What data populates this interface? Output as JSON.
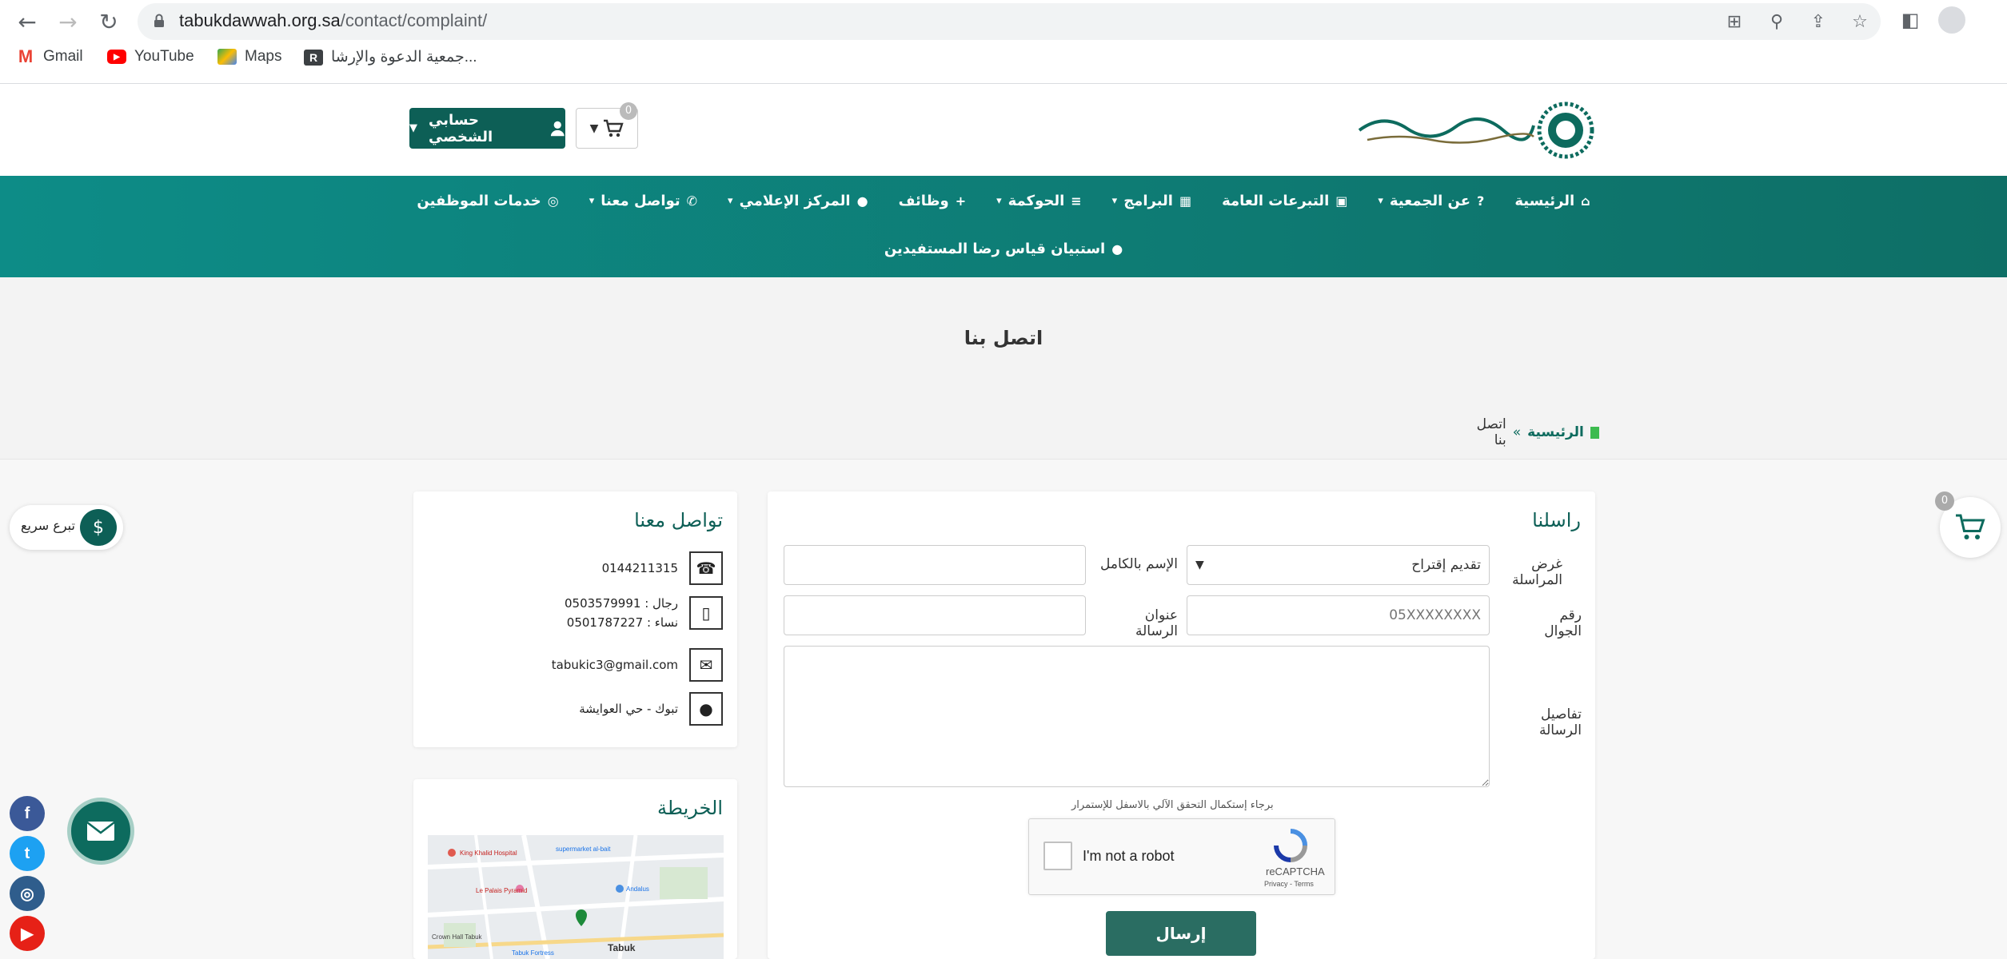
{
  "browser": {
    "url_host": "tabukdawwah.org.sa",
    "url_path": "/contact/complaint/",
    "bookmarks": [
      {
        "label": "Gmail",
        "icon": "gmail-icon",
        "color": "#ea4335"
      },
      {
        "label": "YouTube",
        "icon": "youtube-icon",
        "color": "#ff0000"
      },
      {
        "label": "Maps",
        "icon": "maps-icon",
        "color": "#34a853"
      },
      {
        "label": "جمعية الدعوة والإرشا...",
        "icon": "r-icon",
        "color": "#3c4043"
      }
    ]
  },
  "header": {
    "account_label": "حسابي الشخصي",
    "cart_count": "0"
  },
  "nav": {
    "row1": [
      {
        "label": "الرئيسية",
        "icon": "⌂",
        "chevron": false
      },
      {
        "label": "عن الجمعية",
        "icon": "?",
        "chevron": true
      },
      {
        "label": "التبرعات العامة",
        "icon": "▣",
        "chevron": false
      },
      {
        "label": "البرامج",
        "icon": "▦",
        "chevron": true
      },
      {
        "label": "الحوكمة",
        "icon": "≡",
        "chevron": true
      },
      {
        "label": "وظائف",
        "icon": "+",
        "chevron": false
      },
      {
        "label": "المركز الإعلامي",
        "icon": "●",
        "chevron": true
      },
      {
        "label": "تواصل معنا",
        "icon": "✆",
        "chevron": true
      },
      {
        "label": "خدمات الموظفين",
        "icon": "◎",
        "chevron": false
      }
    ],
    "row2": [
      {
        "label": "استبيان قياس رضا المستفيدين",
        "icon": "●",
        "chevron": false
      }
    ]
  },
  "hero": {
    "title": "اتصل بنا",
    "breadcrumb_home": "الرئيسية",
    "breadcrumb_sep": "»",
    "breadcrumb_current": "اتصل بنا"
  },
  "form": {
    "title": "راسلنا",
    "purpose_label": "غرض المراسلة",
    "purpose_value": "تقديم إقتراح",
    "name_label": "الإسم بالكامل",
    "name_value": "",
    "mobile_label": "رقم الجوال",
    "mobile_placeholder": "05XXXXXXXX",
    "subject_label": "عنوان الرسالة",
    "subject_value": "",
    "details_label": "تفاصيل الرسالة",
    "captcha_note": "برجاء إستكمال التحقق الآلي بالاسفل للإستمرار",
    "captcha_text": "I'm not a robot",
    "captcha_brand": "reCAPTCHA",
    "captcha_links": "Privacy - Terms",
    "submit_label": "إرسال"
  },
  "contact": {
    "title": "تواصل معنا",
    "phone": "0144211315",
    "mobile_men": "رجال : 0503579991",
    "mobile_women": "نساء : 0501787227",
    "email": "tabukic3@gmail.com",
    "address": "تبوك - حي العوايشة"
  },
  "map": {
    "title": "الخريطة",
    "labels": {
      "hospital": "King Khalid Hospital",
      "supermarket": "supermarket al-bait",
      "palais": "Le Palais Pyramid",
      "crown": "Crown Hall Tabuk",
      "fortress": "Tabuk Fortress",
      "city": "Tabuk",
      "andalus": "Andalus"
    }
  },
  "floating": {
    "donate_label": "تبرع سريع",
    "cart_count": "0",
    "socials": [
      {
        "name": "facebook",
        "glyph": "f",
        "color": "#3b5998"
      },
      {
        "name": "twitter",
        "glyph": "t",
        "color": "#1da1f2"
      },
      {
        "name": "instagram",
        "glyph": "◎",
        "color": "#2f5d8c"
      },
      {
        "name": "youtube",
        "glyph": "▶",
        "color": "#e62117"
      }
    ]
  }
}
